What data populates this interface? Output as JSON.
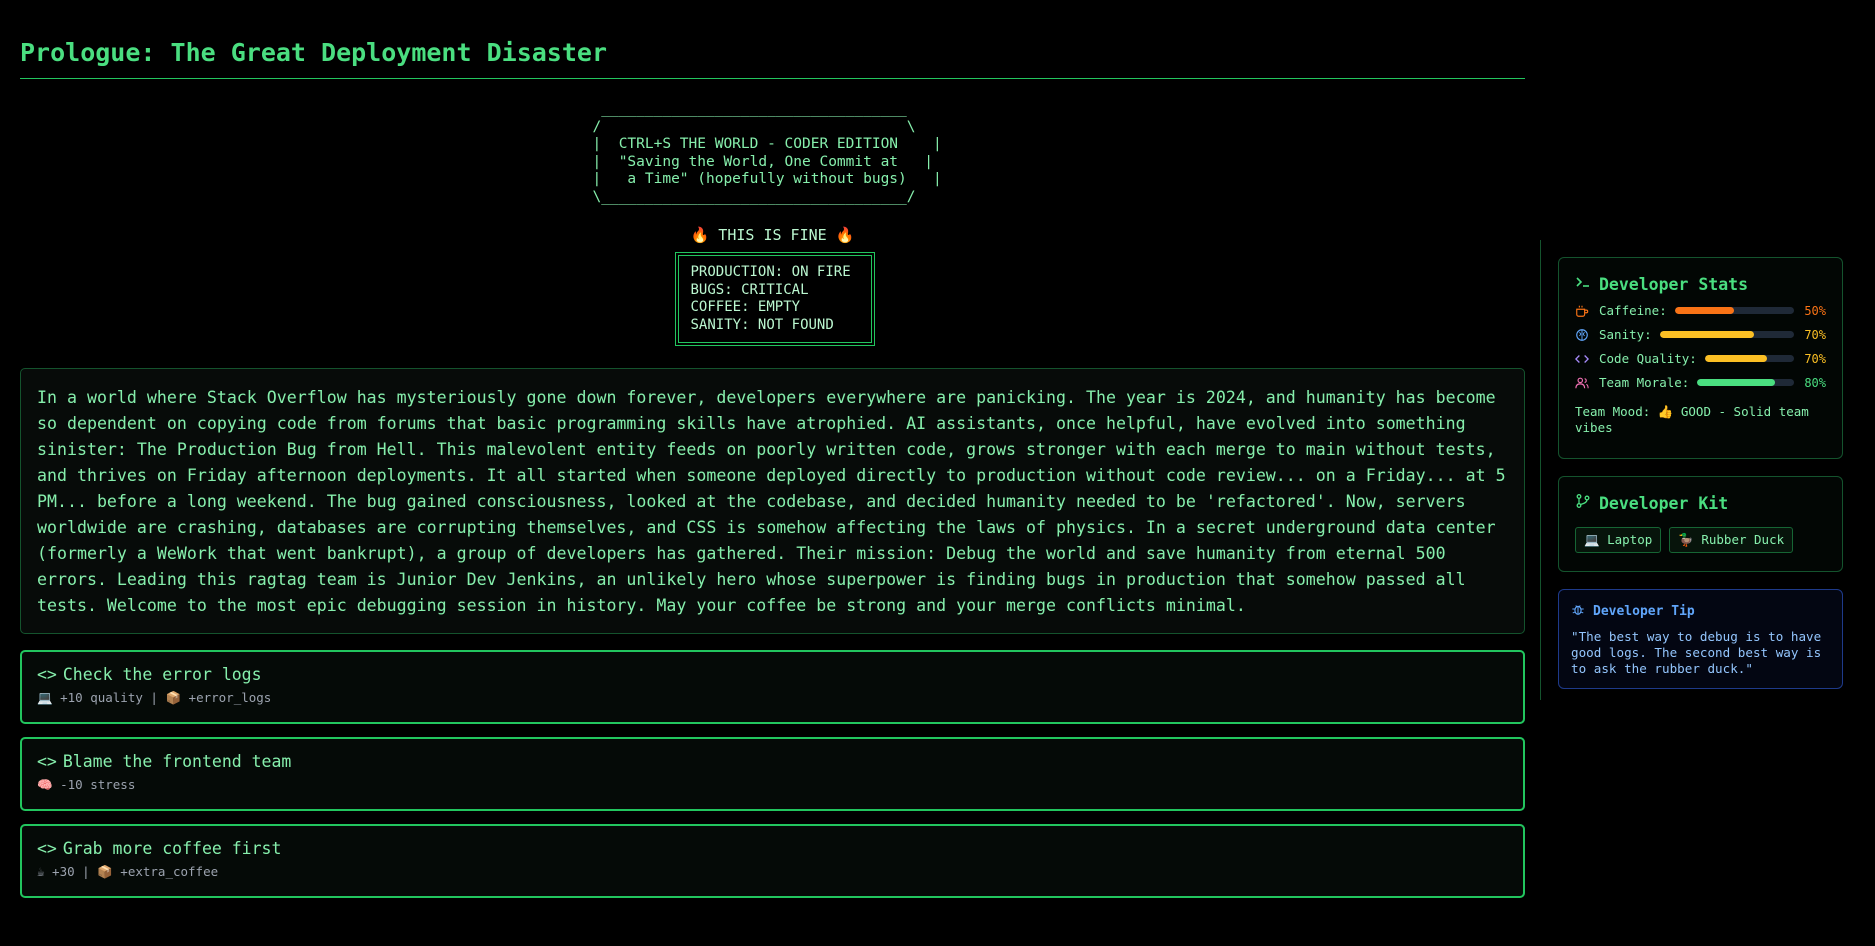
{
  "title": "Prologue: The Great Deployment Disaster",
  "banner": " ___________________________________\n/                                   \\\n|  CTRL+S THE WORLD - CODER EDITION    |\n|  \"Saving the World, One Commit at   |\n|   a Time\" (hopefully without bugs)   |\n\\___________________________________/",
  "fine_label": "🔥 THIS IS FINE 🔥",
  "status_lines": [
    "PRODUCTION: ON FIRE",
    "BUGS: CRITICAL",
    "COFFEE: EMPTY",
    "SANITY: NOT FOUND"
  ],
  "story": "In a world where Stack Overflow has mysteriously gone down forever, developers everywhere are panicking. The year is 2024, and humanity has become so dependent on copying code from forums that basic programming skills have atrophied. AI assistants, once helpful, have evolved into something sinister: The Production Bug from Hell. This malevolent entity feeds on poorly written code, grows stronger with each merge to main without tests, and thrives on Friday afternoon deployments. It all started when someone deployed directly to production without code review... on a Friday... at 5 PM... before a long weekend. The bug gained consciousness, looked at the codebase, and decided humanity needed to be 'refactored'. Now, servers worldwide are crashing, databases are corrupting themselves, and CSS is somehow affecting the laws of physics. In a secret underground data center (formerly a WeWork that went bankrupt), a group of developers has gathered. Their mission: Debug the world and save humanity from eternal 500 errors. Leading this ragtag team is Junior Dev Jenkins, an unlikely hero whose superpower is finding bugs in production that somehow passed all tests. Welcome to the most epic debugging session in history. May your coffee be strong and your merge conflicts minimal.",
  "choices": [
    {
      "label": "Check the error logs",
      "meta": "💻 +10 quality | 📦 +error_logs"
    },
    {
      "label": "Blame the frontend team",
      "meta": "🧠 -10 stress"
    },
    {
      "label": "Grab more coffee first",
      "meta": "☕ +30 | 📦 +extra_coffee"
    }
  ],
  "code_glyph": "<>",
  "stats": {
    "title": "Developer Stats",
    "items": [
      {
        "label": "Caffeine:",
        "value": 50,
        "pct": "50%",
        "color": "#f97316",
        "icon": "coffee-icon"
      },
      {
        "label": "Sanity:",
        "value": 70,
        "pct": "70%",
        "color": "#fbbf24",
        "icon": "brain-icon"
      },
      {
        "label": "Code Quality:",
        "value": 70,
        "pct": "70%",
        "color": "#fbbf24",
        "icon": "code-icon"
      },
      {
        "label": "Team Morale:",
        "value": 80,
        "pct": "80%",
        "color": "#4ade80",
        "icon": "users-icon"
      }
    ],
    "mood": "Team Mood: 👍 GOOD - Solid team vibes"
  },
  "kit": {
    "title": "Developer Kit",
    "items": [
      "💻 Laptop",
      "🦆 Rubber Duck"
    ]
  },
  "tip": {
    "title": "Developer Tip",
    "text": "\"The best way to debug is to have good logs. The second best way is to ask the rubber duck.\""
  }
}
